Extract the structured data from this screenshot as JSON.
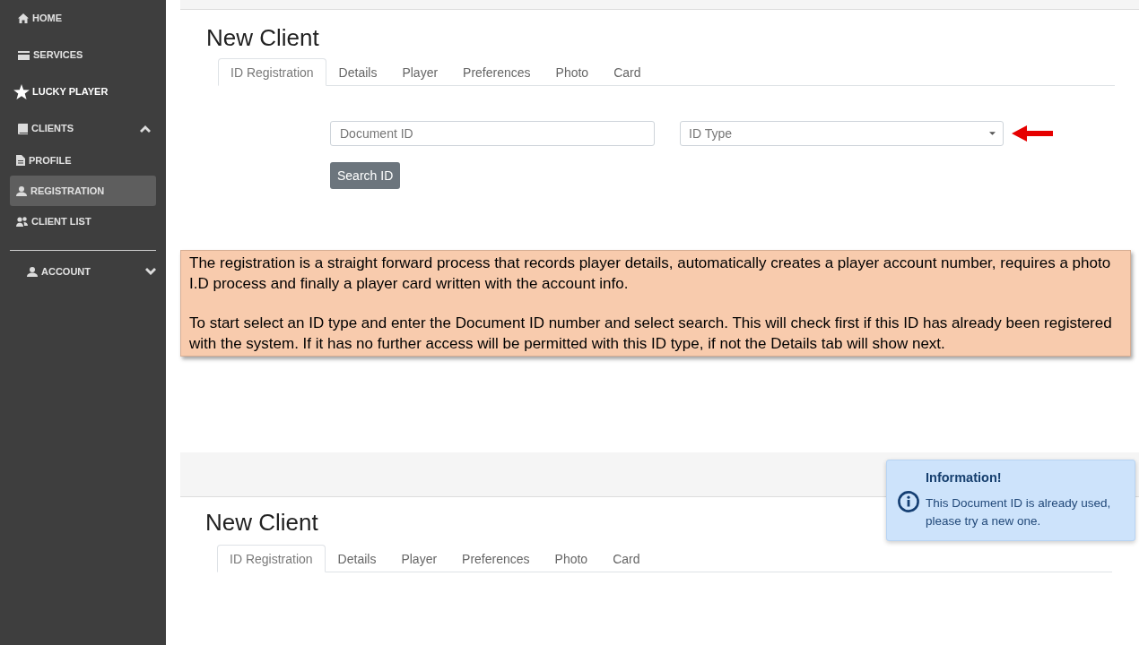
{
  "sidebar": {
    "items": [
      {
        "label": "HOME",
        "selected": false
      },
      {
        "label": "SERVICES",
        "selected": false
      },
      {
        "label": "LUCKY PLAYER",
        "selected": false
      },
      {
        "label": "CLIENTS",
        "selected": false,
        "expanded": true,
        "children": [
          {
            "label": "PROFILE",
            "selected": false
          },
          {
            "label": "REGISTRATION",
            "selected": true
          },
          {
            "label": "CLIENT LIST",
            "selected": false
          }
        ]
      }
    ],
    "bottom_items": [
      {
        "label": "ACCOUNT",
        "selected": false,
        "expanded": false
      }
    ]
  },
  "screen_top": {
    "title": "New Client",
    "tabs": [
      {
        "label": "ID Registration",
        "selected": true
      },
      {
        "label": "Details",
        "selected": false
      },
      {
        "label": "Player",
        "selected": false
      },
      {
        "label": "Preferences",
        "selected": false
      },
      {
        "label": "Photo",
        "selected": false
      },
      {
        "label": "Card",
        "selected": false
      }
    ],
    "document_id": {
      "placeholder": "Document ID"
    },
    "id_type": {
      "placeholder": "ID Type"
    },
    "search_button": {
      "label": "Search ID"
    }
  },
  "callout": {
    "paragraphs": [
      "The registration is a straight forward process that records player details, automatically creates a player account number, requires a photo I.D process and finally a player card written with the account info.",
      "To start select an ID type and enter the Document ID number and select search. This will check first if this ID has already been registered with the system. If it has no further access will be permitted with this ID type, if not the Details tab will show next."
    ]
  },
  "screen_bottom": {
    "title": "New Client",
    "tabs": [
      {
        "label": "ID Registration",
        "selected": true
      },
      {
        "label": "Details",
        "selected": false
      },
      {
        "label": "Player",
        "selected": false
      },
      {
        "label": "Preferences",
        "selected": false
      },
      {
        "label": "Photo",
        "selected": false
      },
      {
        "label": "Card",
        "selected": false
      }
    ],
    "notification": {
      "title": "Information!",
      "message": "This Document ID is already used, please try a new one."
    }
  }
}
